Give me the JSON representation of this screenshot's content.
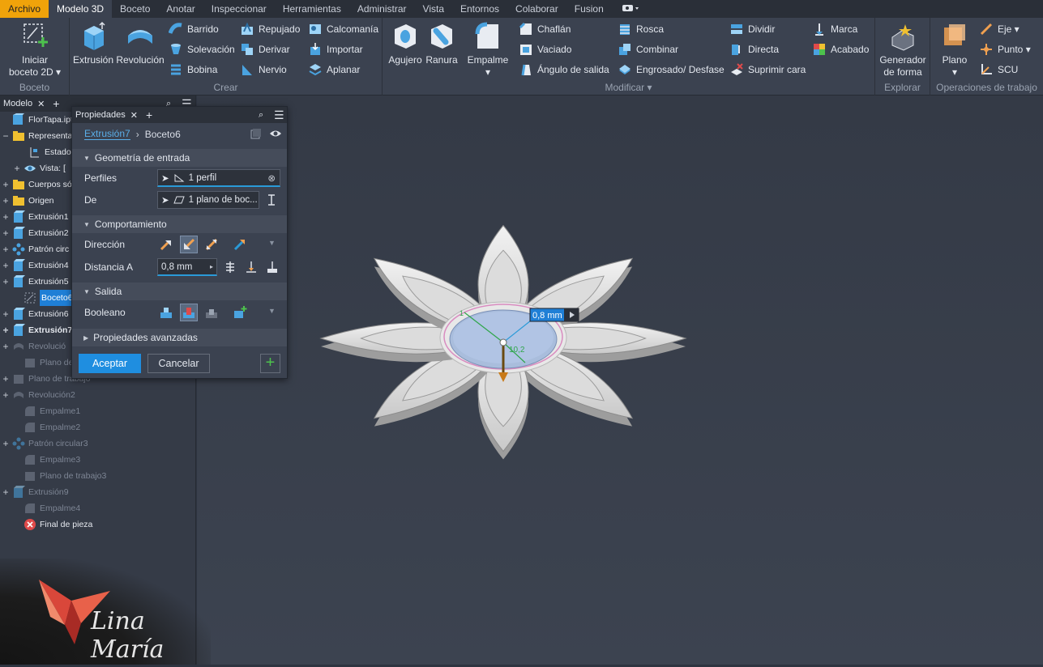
{
  "menubar": {
    "tabs": [
      "Archivo",
      "Modelo 3D",
      "Boceto",
      "Anotar",
      "Inspeccionar",
      "Herramientas",
      "Administrar",
      "Vista",
      "Entornos",
      "Colaborar",
      "Fusion"
    ],
    "active": "Modelo 3D"
  },
  "ribbon": {
    "boceto": {
      "label": "Boceto",
      "iniciar": "Iniciar",
      "boceto2d": "boceto 2D"
    },
    "crear": {
      "label": "Crear",
      "extrusion": "Extrusión",
      "revolucion": "Revolución",
      "barrido": "Barrido",
      "solevacion": "Solevación",
      "bobina": "Bobina",
      "repujado": "Repujado",
      "derivar": "Derivar",
      "nervio": "Nervio",
      "calcomania": "Calcomanía",
      "importar": "Importar",
      "aplanar": "Aplanar"
    },
    "modificar": {
      "label": "Modificar",
      "agujero": "Agujero",
      "ranura": "Ranura",
      "empalme": "Empalme",
      "chaflan": "Chaflán",
      "vaciado": "Vaciado",
      "angulo": "Ángulo de salida",
      "rosca": "Rosca",
      "combinar": "Combinar",
      "engrosado": "Engrosado/ Desfase",
      "dividir": "Dividir",
      "directa": "Directa",
      "suprimir": "Suprimir cara",
      "marca": "Marca",
      "acabado": "Acabado"
    },
    "explorar": {
      "label": "Explorar",
      "generador": "Generador",
      "deforma": "de forma"
    },
    "operaciones": {
      "label": "Operaciones de trabajo",
      "plano": "Plano",
      "eje": "Eje",
      "punto": "Punto",
      "scu": "SCU"
    }
  },
  "browser": {
    "tab": "Modelo",
    "items": [
      {
        "label": "FlorTapa.ipt"
      },
      {
        "label": "Representa"
      },
      {
        "label": "Estado"
      },
      {
        "label": "Vista: ["
      },
      {
        "label": "Cuerpos só"
      },
      {
        "label": "Origen"
      },
      {
        "label": "Extrusión1"
      },
      {
        "label": "Extrusión2"
      },
      {
        "label": "Patrón circ"
      },
      {
        "label": "Extrusión4"
      },
      {
        "label": "Extrusión5"
      },
      {
        "label": "Boceto6"
      },
      {
        "label": "Extrusión6"
      },
      {
        "label": "Extrusión7"
      },
      {
        "label": "Revolució"
      },
      {
        "label": "Plano de tr"
      },
      {
        "label": "Plano de trabajo"
      },
      {
        "label": "Revolución2"
      },
      {
        "label": "Empalme1"
      },
      {
        "label": "Empalme2"
      },
      {
        "label": "Patrón circular3"
      },
      {
        "label": "Empalme3"
      },
      {
        "label": "Plano de trabajo3"
      },
      {
        "label": "Extrusión9"
      },
      {
        "label": "Empalme4"
      },
      {
        "label": "Final de pieza"
      }
    ]
  },
  "props": {
    "tab": "Propiedades",
    "crumb_parent": "Extrusión7",
    "crumb_current": "Boceto6",
    "geom_title": "Geometría de entrada",
    "perfiles_label": "Perfiles",
    "perfiles_value": "1 perfil",
    "de_label": "De",
    "de_value": "1 plano de boc...",
    "comp_title": "Comportamiento",
    "direccion_label": "Dirección",
    "distancia_label": "Distancia A",
    "distancia_value": "0,8 mm",
    "salida_title": "Salida",
    "booleano_label": "Booleano",
    "avanzadas_title": "Propiedades avanzadas",
    "ok": "Aceptar",
    "cancel": "Cancelar"
  },
  "viewport": {
    "dim_value": "0,8 mm",
    "dim_small": "10,2",
    "dim_one": "1"
  },
  "watermark": {
    "text": "Lina María"
  }
}
